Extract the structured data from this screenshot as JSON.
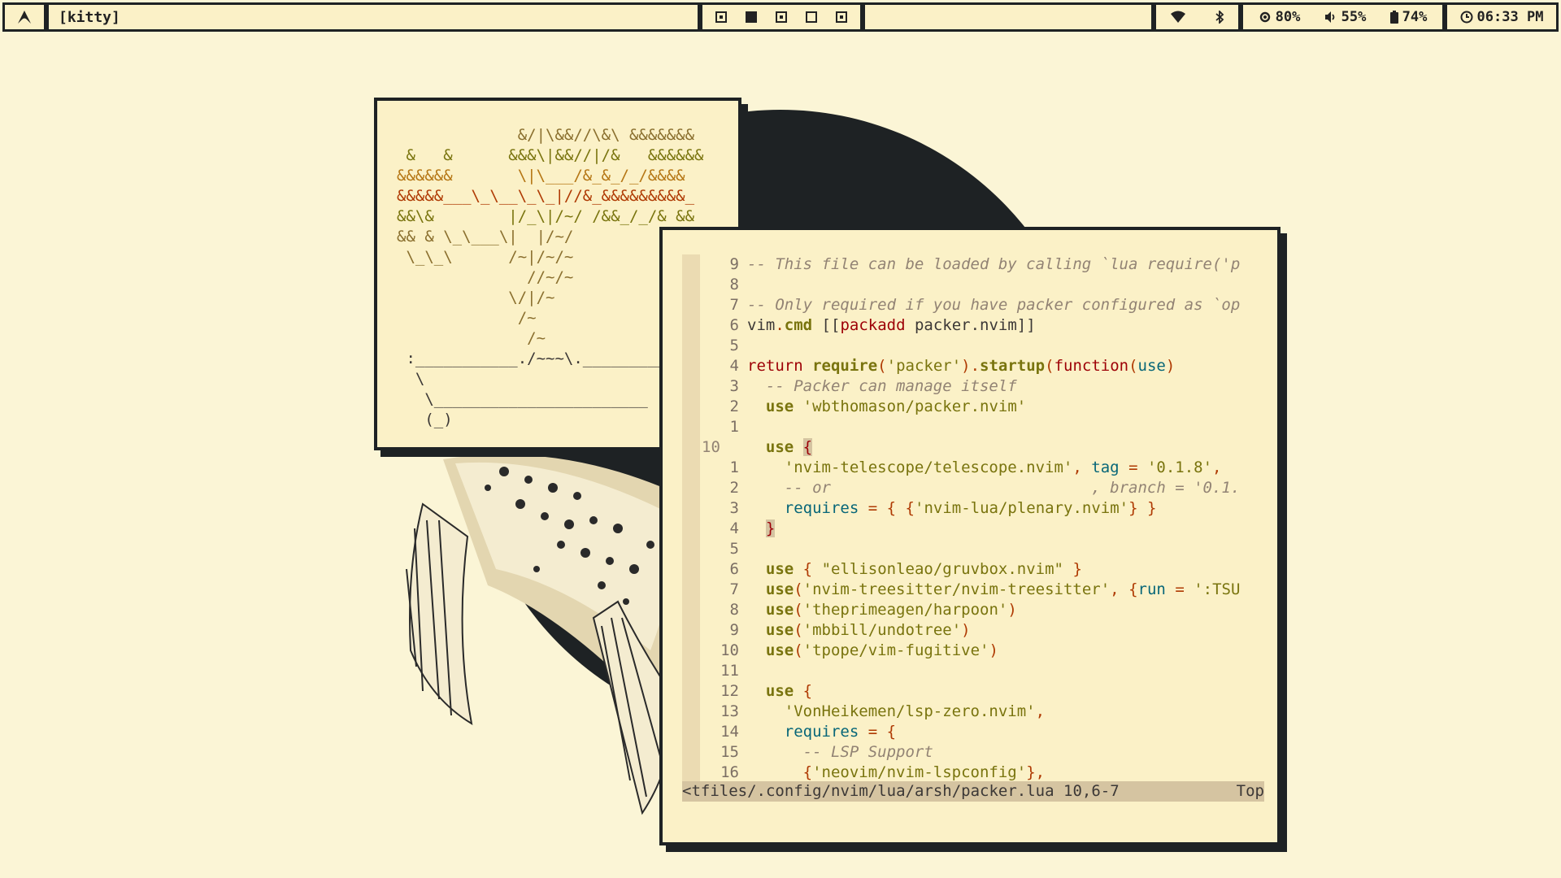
{
  "taskbar": {
    "launcher_icon": "arch-icon",
    "window_title": "[kitty]",
    "workspaces": [
      {
        "label": "1",
        "state": "occupied"
      },
      {
        "label": "2",
        "state": "active"
      },
      {
        "label": "3",
        "state": "occupied"
      },
      {
        "label": "4",
        "state": "empty"
      },
      {
        "label": "5",
        "state": "occupied"
      }
    ],
    "wifi_icon": "wifi-icon",
    "bluetooth_icon": "bluetooth-icon",
    "brightness": "80%",
    "volume": "55%",
    "battery": "74%",
    "clock": "06:33 PM"
  },
  "colors": {
    "background": "#fbf5d6",
    "border": "#1e2224",
    "window_bg": "#fbf1c7",
    "gutter": "#ebdbb2",
    "statusline": "#d5c4a1"
  },
  "ascii_art": [
    "             &/|\\&&//\\&\\ &&&&&&&",
    " &   &      &&&\\|&&//|/&   &&&&&&",
    "&&&&&&       \\|\\___/&_&_/_/&&&&",
    "&&&&&___\\_\\__\\_\\_|//&_&&&&&&&&&_",
    "&&\\&        |/_\\|/~/ /&&_/_/& &&",
    "&& & \\_\\___\\|  |/~/",
    " \\_\\_\\      /~|/~/~",
    "              //~/~",
    "            \\/|/~",
    "             /~",
    "              /~",
    " :___________./~~~\\.___________",
    "  \\",
    "   \\_______________________",
    "   (_)"
  ],
  "editor": {
    "lines": [
      {
        "num": "9",
        "segs": [
          {
            "c": "cm",
            "t": "-- This file can be loaded by calling `lua require('p"
          }
        ]
      },
      {
        "num": "8",
        "segs": []
      },
      {
        "num": "7",
        "segs": [
          {
            "c": "cm",
            "t": "-- Only required if you have packer configured as `op"
          }
        ]
      },
      {
        "num": "6",
        "segs": [
          {
            "c": "df",
            "t": "vim"
          },
          {
            "c": "pn",
            "t": "."
          },
          {
            "c": "fn",
            "t": "cmd"
          },
          {
            "c": "df",
            "t": " [["
          },
          {
            "c": "kw",
            "t": "packadd"
          },
          {
            "c": "df",
            "t": " packer.nvim]]"
          }
        ]
      },
      {
        "num": "5",
        "segs": []
      },
      {
        "num": "4",
        "segs": [
          {
            "c": "kw",
            "t": "return"
          },
          {
            "c": "df",
            "t": " "
          },
          {
            "c": "fn",
            "t": "require"
          },
          {
            "c": "pn",
            "t": "("
          },
          {
            "c": "st",
            "t": "'packer'"
          },
          {
            "c": "pn",
            "t": ")."
          },
          {
            "c": "fn",
            "t": "startup"
          },
          {
            "c": "pn",
            "t": "("
          },
          {
            "c": "kw",
            "t": "function"
          },
          {
            "c": "pn",
            "t": "("
          },
          {
            "c": "id",
            "t": "use"
          },
          {
            "c": "pn",
            "t": ")"
          }
        ]
      },
      {
        "num": "3",
        "segs": [
          {
            "c": "df",
            "t": "  "
          },
          {
            "c": "cm",
            "t": "-- Packer can manage itself"
          }
        ]
      },
      {
        "num": "2",
        "segs": [
          {
            "c": "df",
            "t": "  "
          },
          {
            "c": "fn",
            "t": "use"
          },
          {
            "c": "df",
            "t": " "
          },
          {
            "c": "st",
            "t": "'wbthomason/packer.nvim'"
          }
        ]
      },
      {
        "num": "1",
        "segs": []
      },
      {
        "num": "10",
        "cur": true,
        "segs": [
          {
            "c": "df",
            "t": "  "
          },
          {
            "c": "fn",
            "t": "use"
          },
          {
            "c": "df",
            "t": " "
          },
          {
            "c": "cur-br",
            "t": "{"
          }
        ]
      },
      {
        "num": "1",
        "segs": [
          {
            "c": "df",
            "t": "    "
          },
          {
            "c": "st",
            "t": "'nvim-telescope/telescope.nvim'"
          },
          {
            "c": "pn",
            "t": ","
          },
          {
            "c": "df",
            "t": " "
          },
          {
            "c": "id",
            "t": "tag"
          },
          {
            "c": "df",
            "t": " "
          },
          {
            "c": "pn",
            "t": "="
          },
          {
            "c": "df",
            "t": " "
          },
          {
            "c": "st",
            "t": "'0.1.8'"
          },
          {
            "c": "pn",
            "t": ","
          }
        ]
      },
      {
        "num": "2",
        "segs": [
          {
            "c": "df",
            "t": "    "
          },
          {
            "c": "cm",
            "t": "-- or                            , branch = '0.1."
          }
        ]
      },
      {
        "num": "3",
        "segs": [
          {
            "c": "df",
            "t": "    "
          },
          {
            "c": "id",
            "t": "requires"
          },
          {
            "c": "df",
            "t": " "
          },
          {
            "c": "pn",
            "t": "="
          },
          {
            "c": "df",
            "t": " "
          },
          {
            "c": "pn",
            "t": "{"
          },
          {
            "c": "df",
            "t": " "
          },
          {
            "c": "pn",
            "t": "{"
          },
          {
            "c": "st",
            "t": "'nvim-lua/plenary.nvim'"
          },
          {
            "c": "pn",
            "t": "}"
          },
          {
            "c": "df",
            "t": " "
          },
          {
            "c": "pn",
            "t": "}"
          }
        ]
      },
      {
        "num": "4",
        "segs": [
          {
            "c": "df",
            "t": "  "
          },
          {
            "c": "cur-br",
            "t": "}"
          }
        ]
      },
      {
        "num": "5",
        "segs": []
      },
      {
        "num": "6",
        "segs": [
          {
            "c": "df",
            "t": "  "
          },
          {
            "c": "fn",
            "t": "use"
          },
          {
            "c": "df",
            "t": " "
          },
          {
            "c": "pn",
            "t": "{"
          },
          {
            "c": "df",
            "t": " "
          },
          {
            "c": "st",
            "t": "\"ellisonleao/gruvbox.nvim\""
          },
          {
            "c": "df",
            "t": " "
          },
          {
            "c": "pn",
            "t": "}"
          }
        ]
      },
      {
        "num": "7",
        "segs": [
          {
            "c": "df",
            "t": "  "
          },
          {
            "c": "fn",
            "t": "use"
          },
          {
            "c": "pn",
            "t": "("
          },
          {
            "c": "st",
            "t": "'nvim-treesitter/nvim-treesitter'"
          },
          {
            "c": "pn",
            "t": ","
          },
          {
            "c": "df",
            "t": " "
          },
          {
            "c": "pn",
            "t": "{"
          },
          {
            "c": "id",
            "t": "run"
          },
          {
            "c": "df",
            "t": " "
          },
          {
            "c": "pn",
            "t": "="
          },
          {
            "c": "df",
            "t": " "
          },
          {
            "c": "st",
            "t": "':TSU"
          }
        ]
      },
      {
        "num": "8",
        "segs": [
          {
            "c": "df",
            "t": "  "
          },
          {
            "c": "fn",
            "t": "use"
          },
          {
            "c": "pn",
            "t": "("
          },
          {
            "c": "st",
            "t": "'theprimeagen/harpoon'"
          },
          {
            "c": "pn",
            "t": ")"
          }
        ]
      },
      {
        "num": "9",
        "segs": [
          {
            "c": "df",
            "t": "  "
          },
          {
            "c": "fn",
            "t": "use"
          },
          {
            "c": "pn",
            "t": "("
          },
          {
            "c": "st",
            "t": "'mbbill/undotree'"
          },
          {
            "c": "pn",
            "t": ")"
          }
        ]
      },
      {
        "num": "10",
        "segs": [
          {
            "c": "df",
            "t": "  "
          },
          {
            "c": "fn",
            "t": "use"
          },
          {
            "c": "pn",
            "t": "("
          },
          {
            "c": "st",
            "t": "'tpope/vim-fugitive'"
          },
          {
            "c": "pn",
            "t": ")"
          }
        ]
      },
      {
        "num": "11",
        "segs": []
      },
      {
        "num": "12",
        "segs": [
          {
            "c": "df",
            "t": "  "
          },
          {
            "c": "fn",
            "t": "use"
          },
          {
            "c": "df",
            "t": " "
          },
          {
            "c": "pn",
            "t": "{"
          }
        ]
      },
      {
        "num": "13",
        "segs": [
          {
            "c": "df",
            "t": "    "
          },
          {
            "c": "st",
            "t": "'VonHeikemen/lsp-zero.nvim'"
          },
          {
            "c": "pn",
            "t": ","
          }
        ]
      },
      {
        "num": "14",
        "segs": [
          {
            "c": "df",
            "t": "    "
          },
          {
            "c": "id",
            "t": "requires"
          },
          {
            "c": "df",
            "t": " "
          },
          {
            "c": "pn",
            "t": "="
          },
          {
            "c": "df",
            "t": " "
          },
          {
            "c": "pn",
            "t": "{"
          }
        ]
      },
      {
        "num": "15",
        "segs": [
          {
            "c": "df",
            "t": "      "
          },
          {
            "c": "cm",
            "t": "-- LSP Support"
          }
        ]
      },
      {
        "num": "16",
        "segs": [
          {
            "c": "df",
            "t": "      "
          },
          {
            "c": "pn",
            "t": "{"
          },
          {
            "c": "st",
            "t": "'neovim/nvim-lspconfig'"
          },
          {
            "c": "pn",
            "t": "},"
          }
        ]
      }
    ],
    "status_path": "<tfiles/.config/nvim/lua/arsh/packer.lua",
    "status_pos": "10,6-7",
    "status_scroll": "Top"
  }
}
